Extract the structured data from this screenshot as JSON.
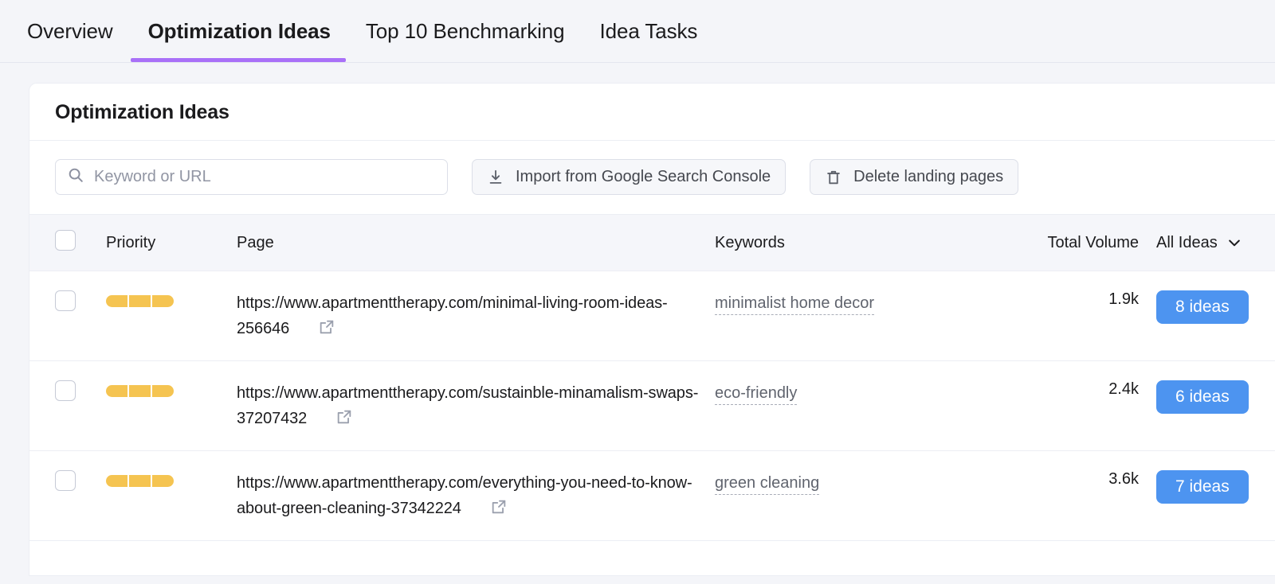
{
  "tabs": [
    {
      "label": "Overview",
      "active": false
    },
    {
      "label": "Optimization Ideas",
      "active": true
    },
    {
      "label": "Top 10 Benchmarking",
      "active": false
    },
    {
      "label": "Idea Tasks",
      "active": false
    }
  ],
  "card": {
    "title": "Optimization Ideas"
  },
  "toolbar": {
    "search_placeholder": "Keyword or URL",
    "search_value": "",
    "import_label": "Import from Google Search Console",
    "delete_label": "Delete landing pages"
  },
  "table": {
    "headers": {
      "priority": "Priority",
      "page": "Page",
      "keywords": "Keywords",
      "volume": "Total Volume",
      "ideas_filter": "All Ideas"
    },
    "rows": [
      {
        "priority_filled": 3,
        "priority_total": 3,
        "page": "https://www.apartmenttherapy.com/minimal-living-room-ideas-256646",
        "keyword": "minimalist home decor",
        "volume": "1.9k",
        "ideas": "8 ideas"
      },
      {
        "priority_filled": 3,
        "priority_total": 3,
        "page": "https://www.apartmenttherapy.com/sustainble-minamalism-swaps-37207432",
        "keyword": "eco-friendly",
        "volume": "2.4k",
        "ideas": "6 ideas"
      },
      {
        "priority_filled": 3,
        "priority_total": 3,
        "page": "https://www.apartmenttherapy.com/everything-you-need-to-know-about-green-cleaning-37342224",
        "keyword": "green cleaning",
        "volume": "3.6k",
        "ideas": "7 ideas"
      }
    ]
  },
  "colors": {
    "accent_tab": "#a970f8",
    "priority_bar": "#f5c451",
    "badge": "#4d94f0",
    "page_bg": "#f4f5f9"
  },
  "icons": {
    "search": "search-icon",
    "import": "download-icon",
    "delete": "trash-icon",
    "external": "external-link-icon",
    "dropdown": "chevron-down-icon"
  }
}
